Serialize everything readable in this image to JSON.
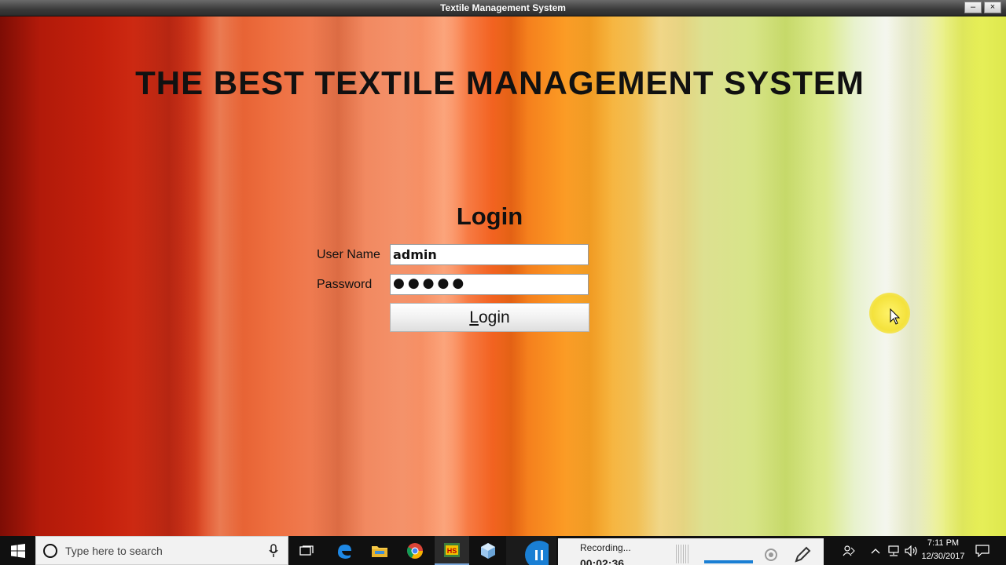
{
  "window": {
    "title": "Textile Management System",
    "buttons": {
      "minimize": "–",
      "close": "×"
    }
  },
  "app": {
    "main_title": "THE BEST TEXTILE MANAGEMENT SYSTEM",
    "login_heading": "Login",
    "username_label": "User Name",
    "username_value": "admin",
    "password_label": "Password",
    "password_mask": "●●●●●",
    "login_button_first": "L",
    "login_button_rest": "ogin"
  },
  "taskbar": {
    "search_placeholder": "Type here to search",
    "recording_label": "Recording...",
    "recording_time": "00:02:36",
    "time": "7:11 PM",
    "date": "12/30/2017",
    "icons": [
      "windows-start-icon",
      "cortana-circle-icon",
      "microphone-icon",
      "task-view-icon",
      "edge-icon",
      "file-explorer-icon",
      "chrome-icon",
      "hs-app-icon",
      "cube-app-icon",
      "pause-recording-icon",
      "webcam-icon",
      "pen-icon",
      "people-icon",
      "chevron-up-icon",
      "network-icon",
      "volume-icon",
      "notification-icon"
    ]
  },
  "colors": {
    "titlebar": "#3a3a3a",
    "taskbar": "#101010",
    "cursor_highlight": "#f4e23c",
    "pause_button": "#1a7fd4"
  }
}
